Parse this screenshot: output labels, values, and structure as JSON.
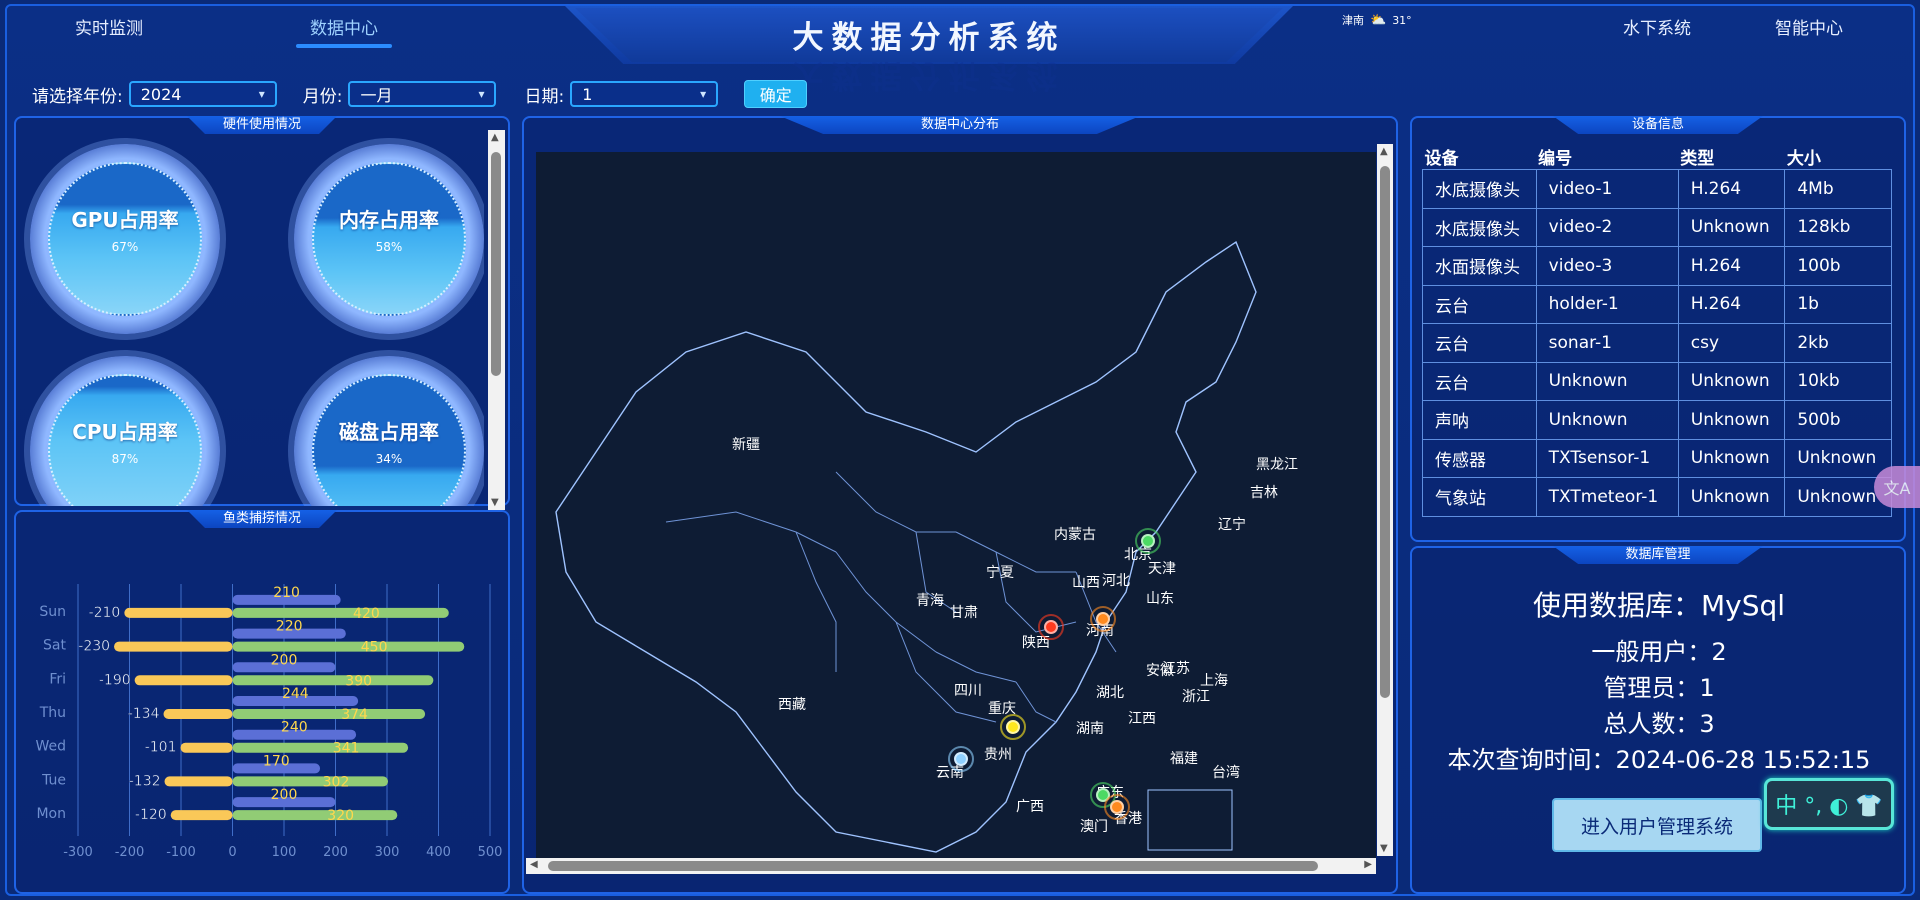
{
  "nav": {
    "left": [
      {
        "label": "实时监测",
        "active": false
      },
      {
        "label": "数据中心",
        "active": true
      }
    ],
    "right": [
      {
        "label": "水下系统"
      },
      {
        "label": "智能中心"
      }
    ]
  },
  "header": {
    "title": "大数据分析系统"
  },
  "weather": {
    "city": "津南",
    "icon": "sun-cloud-icon",
    "temp": "31°"
  },
  "filters": {
    "year_label": "请选择年份:",
    "year_value": "2024",
    "month_label": "月份:",
    "month_value": "一月",
    "day_label": "日期:",
    "day_value": "1",
    "confirm_label": "确定"
  },
  "hardware": {
    "title": "硬件使用情况",
    "gauges": [
      {
        "label": "GPU占用率",
        "value": "67%",
        "fill": 0.67
      },
      {
        "label": "内存占用率",
        "value": "58%",
        "fill": 0.58
      },
      {
        "label": "CPU占用率",
        "value": "87%",
        "fill": 0.87
      },
      {
        "label": "磁盘占用率",
        "value": "34%",
        "fill": 0.34
      }
    ]
  },
  "fishing": {
    "title": "鱼类捕捞情况"
  },
  "chart_data": {
    "type": "bar",
    "orientation": "horizontal",
    "stacked": true,
    "categories": [
      "Mon",
      "Tue",
      "Wed",
      "Thu",
      "Fri",
      "Sat",
      "Sun"
    ],
    "series": [
      {
        "values": [
          200,
          170,
          240,
          244,
          200,
          220,
          210
        ],
        "color": "#5b6fd6"
      },
      {
        "values": [
          320,
          302,
          341,
          374,
          390,
          450,
          420
        ],
        "color": "#91cc75"
      },
      {
        "values": [
          -120,
          -132,
          -101,
          -134,
          -190,
          -230,
          -210
        ],
        "color": "#fac858"
      }
    ],
    "xlim": [
      -300,
      500
    ],
    "xticks": [
      "-300",
      "-200",
      "-100",
      "0",
      "100",
      "200",
      "300",
      "400",
      "500"
    ],
    "grid": true
  },
  "map": {
    "title": "数据中心分布",
    "provinces": [
      {
        "name": "新疆"
      },
      {
        "name": "西藏"
      },
      {
        "name": "青海"
      },
      {
        "name": "甘肃"
      },
      {
        "name": "宁夏"
      },
      {
        "name": "内蒙古"
      },
      {
        "name": "黑龙江"
      },
      {
        "name": "吉林"
      },
      {
        "name": "辽宁"
      },
      {
        "name": "北京"
      },
      {
        "name": "天津"
      },
      {
        "name": "河北"
      },
      {
        "name": "山西"
      },
      {
        "name": "山东"
      },
      {
        "name": "陕西"
      },
      {
        "name": "河南"
      },
      {
        "name": "四川"
      },
      {
        "name": "重庆"
      },
      {
        "name": "湖北"
      },
      {
        "name": "安徽"
      },
      {
        "name": "江苏"
      },
      {
        "name": "上海"
      },
      {
        "name": "浙江"
      },
      {
        "name": "湖南"
      },
      {
        "name": "江西"
      },
      {
        "name": "贵州"
      },
      {
        "name": "云南"
      },
      {
        "name": "广西"
      },
      {
        "name": "广东"
      },
      {
        "name": "福建"
      },
      {
        "name": "台湾"
      },
      {
        "name": "香港"
      },
      {
        "name": "澳门"
      }
    ],
    "markers": [
      {
        "name": "北京",
        "color": "#4cd964"
      },
      {
        "name": "陕西",
        "color": "#ff3b1f"
      },
      {
        "name": "河南",
        "color": "#ff8a1f"
      },
      {
        "name": "贵州",
        "color": "#ffe81f"
      },
      {
        "name": "云南",
        "color": "#8fd0ff"
      },
      {
        "name": "广东",
        "color": "#4cd964"
      },
      {
        "name": "香港",
        "color": "#ff8a1f"
      }
    ]
  },
  "devices": {
    "title": "设备信息",
    "headers": [
      "设备",
      "编号",
      "类型",
      "大小"
    ],
    "rows": [
      [
        "水底摄像头",
        "video-1",
        "H.264",
        "4Mb"
      ],
      [
        "水底摄像头",
        "video-2",
        "Unknown",
        "128kb"
      ],
      [
        "水面摄像头",
        "video-3",
        "H.264",
        "100b"
      ],
      [
        "云台",
        "holder-1",
        "H.264",
        "1b"
      ],
      [
        "云台",
        "sonar-1",
        "csy",
        "2kb"
      ],
      [
        "云台",
        "Unknown",
        "Unknown",
        "10kb"
      ],
      [
        "声呐",
        "Unknown",
        "Unknown",
        "500b"
      ],
      [
        "传感器",
        "TXTsensor-1",
        "Unknown",
        "Unknown"
      ],
      [
        "气象站",
        "TXTmeteor-1",
        "Unknown",
        "Unknown"
      ]
    ]
  },
  "database": {
    "title": "数据库管理",
    "db_line": "使用数据库：MySql",
    "normal_users": "一般用户：2",
    "admins": "管理员：1",
    "total": "总人数：3",
    "query_time": "本次查询时间：2024-06-28 15:52:15",
    "enter_button": "进入用户管理系统"
  },
  "ime": {
    "label": "中 °, ◐ 👕"
  },
  "translate_tab": {
    "icon": "translate-icon"
  }
}
